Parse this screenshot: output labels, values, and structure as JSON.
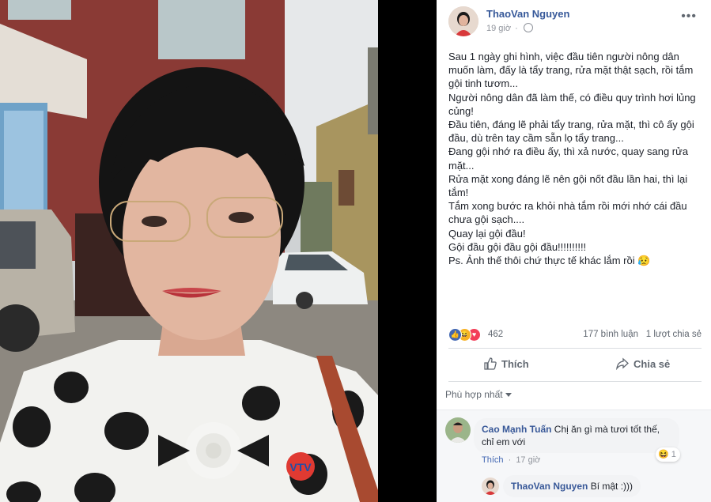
{
  "post": {
    "author": "ThaoVan Nguyen",
    "time": "19 giờ",
    "text": "Sau 1 ngày ghi hình, việc đầu tiên người nông dân muốn làm, đấy là tẩy trang, rửa mặt thật sạch, rồi tắm gội tinh tươm...\nNgười nông dân đã làm thế, có điều quy trình hơi lủng củng!\nĐầu tiên, đáng lẽ phải tẩy trang, rửa mặt, thì cô ấy gội đầu, dù trên tay cầm sẵn lọ tẩy trang...\nĐang gội nhớ ra điều ấy, thì xả nước, quay sang rửa mặt...\nRửa mặt xong đáng lẽ nên gội nốt đầu lần hai, thì lại tắm!\nTắm xong bước ra khỏi nhà tắm rồi mới nhớ cái đầu chưa gội sạch....\nQuay lại gội đầu!\nGội đầu gội đầu gội đầu!!!!!!!!!!\nPs. Ảnh thế thôi chứ thực tế khác lắm rồi 😥",
    "reaction_count": "462",
    "comments_count": "177 bình luận",
    "shares_count": "1 lượt chia sẻ",
    "reaction_icons": [
      "like",
      "haha",
      "love"
    ]
  },
  "actions": {
    "like_label": "Thích",
    "share_label": "Chia sẻ"
  },
  "sort": {
    "label": "Phù hợp nhất"
  },
  "comments": [
    {
      "author": "Cao Mạnh Tuấn",
      "text": "Chị ăn gì mà tươi tốt thế, chỉ em với",
      "like_label": "Thích",
      "time": "17 giờ",
      "reaction_count": "1"
    },
    {
      "author": "ThaoVan Nguyen",
      "text": "Bí mật :)))"
    }
  ],
  "colors": {
    "link": "#365899",
    "text": "#1d2129",
    "muted": "#90949c",
    "like_blue": "#4267b2",
    "love_red": "#f33e58",
    "haha_yellow": "#f7b125"
  },
  "photo": {
    "logo_text": "VTV"
  }
}
